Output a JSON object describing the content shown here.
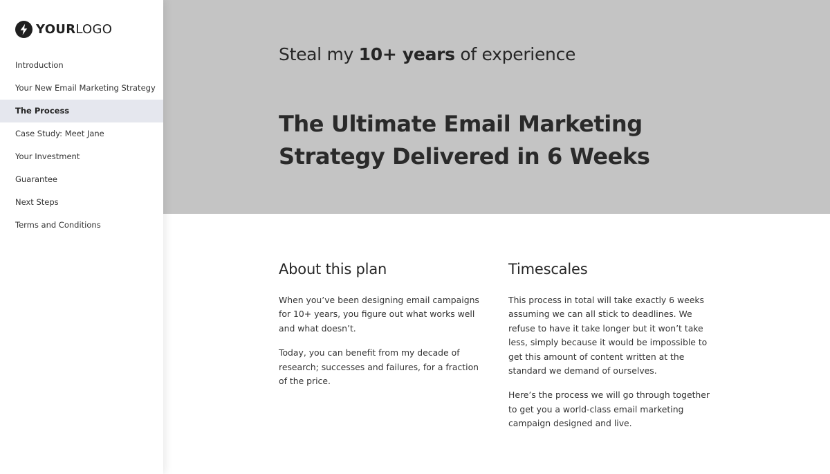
{
  "logo": {
    "icon": "lightning-bolt-icon",
    "text_bold": "YOUR",
    "text_light": "LOGO"
  },
  "sidebar": {
    "items": [
      {
        "label": "Introduction",
        "active": false
      },
      {
        "label": "Your New Email Marketing Strategy",
        "active": false
      },
      {
        "label": "The Process",
        "active": true
      },
      {
        "label": "Case Study: Meet Jane",
        "active": false
      },
      {
        "label": "Your Investment",
        "active": false
      },
      {
        "label": "Guarantee",
        "active": false
      },
      {
        "label": "Next Steps",
        "active": false
      },
      {
        "label": "Terms and Conditions",
        "active": false
      }
    ]
  },
  "hero": {
    "kicker_pre": "Steal my ",
    "kicker_bold": "10+ years",
    "kicker_post": " of experience",
    "title": "The Ultimate Email Marketing Strategy Delivered in 6 Weeks"
  },
  "about": {
    "heading": "About this plan",
    "paragraphs": [
      "When you’ve been designing email campaigns for 10+ years, you figure out what works well and what doesn’t.",
      "Today, you can benefit from my decade of research; successes and failures, for a fraction of the price."
    ]
  },
  "timescales": {
    "heading": "Timescales",
    "paragraphs": [
      "This process in total will take exactly 6 weeks assuming we can all stick to deadlines. We refuse to have it take longer but it won’t take less, simply because it would be impossible to get this amount of content written at the standard we demand of ourselves.",
      "Here’s the process we will go through together to get you a world-class email marketing campaign designed and live."
    ]
  },
  "colors": {
    "hero_bg": "#c4c4c4",
    "active_nav_bg": "#e5e7ee",
    "text_dark": "#2a2a2a"
  }
}
